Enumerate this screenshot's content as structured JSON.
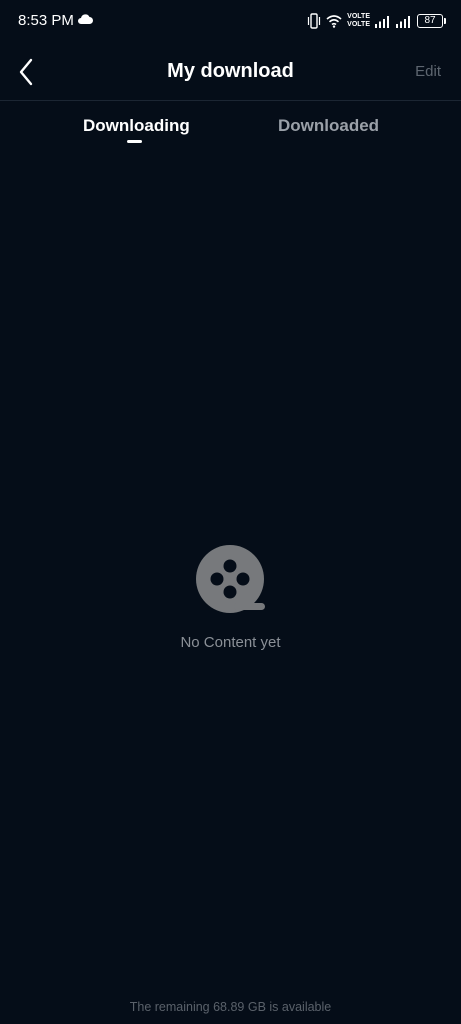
{
  "status_bar": {
    "time": "8:53 PM",
    "volte_1": "VOLTE",
    "volte_2": "VOLTE",
    "battery": "87",
    "icons": [
      "cloud-icon",
      "vibrate-icon",
      "wifi-icon",
      "signal-icon",
      "signal-icon",
      "battery-icon"
    ]
  },
  "header": {
    "title": "My download",
    "edit_label": "Edit"
  },
  "tabs": [
    {
      "label": "Downloading",
      "active": true
    },
    {
      "label": "Downloaded",
      "active": false
    }
  ],
  "empty_state": {
    "icon": "film-reel-icon",
    "message": "No Content yet"
  },
  "footer": {
    "storage_text": "The remaining 68.89 GB is available"
  },
  "colors": {
    "background": "#050d18",
    "active_tab": "#ffffff",
    "inactive_tab": "#9aa0a8",
    "edit": "#5e6670",
    "empty_icon": "#77797c"
  }
}
